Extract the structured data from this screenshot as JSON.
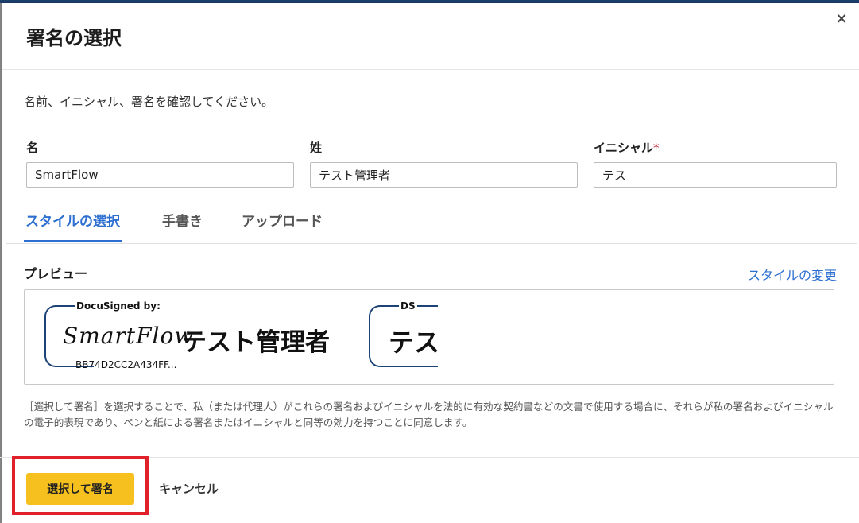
{
  "dialog": {
    "title": "署名の選択",
    "close_label": "×",
    "instruction": "名前、イニシャル、署名を確認してください。"
  },
  "fields": {
    "first_name": {
      "label": "名",
      "value": "SmartFlow"
    },
    "last_name": {
      "label": "姓",
      "value": "テスト管理者"
    },
    "initials": {
      "label": "イニシャル",
      "required_mark": "*",
      "value": "テス"
    }
  },
  "tabs": [
    {
      "label": "スタイルの選択",
      "active": true
    },
    {
      "label": "手書き",
      "active": false
    },
    {
      "label": "アップロード",
      "active": false
    }
  ],
  "preview": {
    "label": "プレビュー",
    "change_style_link": "スタイルの変更",
    "signature": {
      "tag": "DocuSigned by:",
      "script_name": "SmartFlow",
      "name_jp": "テスト管理者",
      "id": "BB74D2CC2A434FF..."
    },
    "initials": {
      "tag": "DS",
      "text": "テス"
    }
  },
  "consent_text": "［選択して署名］を選択することで、私（または代理人）がこれらの署名およびイニシャルを法的に有効な契約書などの文書で使用する場合に、それらが私の署名およびイニシャルの電子的表現であり、ペンと紙による署名またはイニシャルと同等の効力を持つことに同意します。",
  "footer": {
    "primary_label": "選択して署名",
    "cancel_label": "キャンセル"
  },
  "colors": {
    "accent_blue": "#2d6fd1",
    "primary_button": "#f6c01e",
    "highlight_red": "#e0202a",
    "signature_frame": "#1d4275"
  }
}
